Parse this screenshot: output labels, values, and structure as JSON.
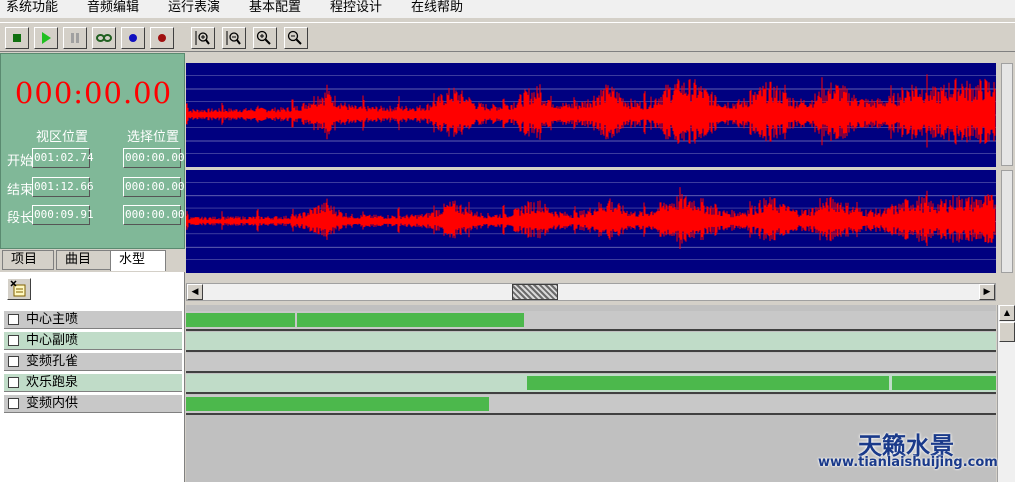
{
  "menu": [
    "系统功能",
    "音频编辑",
    "运行表演",
    "基本配置",
    "程控设计",
    "在线帮助"
  ],
  "toolbar": {
    "buttons": [
      "stop-icon",
      "play-icon",
      "pause-icon",
      "loop-icon",
      "blue-record-icon",
      "red-record-icon",
      "zoom-fit-v-icon",
      "zoom-out-v-icon",
      "zoom-in-icon",
      "zoom-out-icon"
    ]
  },
  "timer": "000:00.00",
  "panel": {
    "col_view": "视区位置",
    "col_select": "选择位置",
    "rows": [
      {
        "label": "开始",
        "view": "001:02.74",
        "select": "000:00.00"
      },
      {
        "label": "结束",
        "view": "001:12.66",
        "select": "000:00.00"
      },
      {
        "label": "段长",
        "view": "000:09.91",
        "select": "000:00.00"
      }
    ]
  },
  "tabs": [
    "项目",
    "曲目",
    "水型"
  ],
  "active_tab": "水型",
  "tracks": [
    {
      "label": "中心主喷",
      "segments": [
        [
          0,
          0.135
        ],
        [
          0.137,
          0.417
        ]
      ]
    },
    {
      "label": "中心副喷",
      "segments": []
    },
    {
      "label": "变频孔雀",
      "segments": []
    },
    {
      "label": "欢乐跑泉",
      "segments": [
        [
          0.421,
          0.868
        ],
        [
          0.871,
          1.0
        ]
      ]
    },
    {
      "label": "变频内供",
      "segments": [
        [
          0,
          0.374
        ]
      ]
    }
  ],
  "watermark": {
    "title": "天籁水景",
    "url": "www.tianlaishuijing.com"
  },
  "colors": {
    "wave_bg": "#000080",
    "wave": "#ff0000",
    "panel": "#80b898",
    "segment": "#4cb84c"
  }
}
